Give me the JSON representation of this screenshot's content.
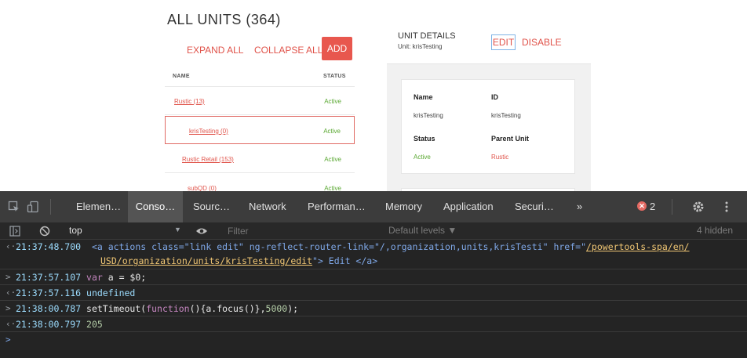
{
  "page": {
    "units_title": "ALL UNITS (364)",
    "actions": {
      "expand_all": "EXPAND ALL",
      "collapse_all": "COLLAPSE ALL",
      "add": "ADD"
    },
    "table": {
      "headers": {
        "name": "NAME",
        "status": "STATUS"
      },
      "rows": [
        {
          "name": "Rustic (13)",
          "status": "Active"
        },
        {
          "name": "krisTesting (0)",
          "status": "Active"
        },
        {
          "name": "Rustic Retail (153)",
          "status": "Active"
        },
        {
          "name": "subQD (0)",
          "status": "Active"
        }
      ]
    },
    "detail": {
      "title": "UNIT DETAILS",
      "subtitle": "Unit: krisTesting",
      "edit": "EDIT",
      "disable": "DISABLE",
      "fields": {
        "name_label": "Name",
        "name_value": "krisTesting",
        "id_label": "ID",
        "id_value": "krisTesting",
        "status_label": "Status",
        "status_value": "Active",
        "parent_label": "Parent Unit",
        "parent_value": "Rustic"
      }
    }
  },
  "devtools": {
    "tabs": [
      "Elemen…",
      "Conso…",
      "Sourc…",
      "Network",
      "Performan…",
      "Memory",
      "Application",
      "Securi…",
      "»"
    ],
    "active_tab": "Conso…",
    "error_count": "2",
    "toolbar": {
      "context": "top",
      "filter_placeholder": "Filter",
      "levels": "Default levels ▼",
      "hidden": "4 hidden"
    },
    "console": {
      "l1_ts": "21:37:48.700",
      "l1_part1": "<a actions class=\"link edit\" ng-reflect-router-link=\"/,organization,units,krisTesti\" href=\"",
      "l1_link1": "/powertools-spa/en/",
      "l1_link2": "USD/organization/units/krisTesting/edit",
      "l1_part2": "\"> Edit </a>",
      "l2_ts": "21:37:57.107",
      "l2_code_kw": "var",
      "l2_code_rest": " a = $0;",
      "l3_ts": "21:37:57.116",
      "l3_value": "undefined",
      "l4_ts": "21:38:00.787",
      "l4_code_a": "setTimeout(",
      "l4_code_kw": "function",
      "l4_code_b": "(){a.focus()},",
      "l4_num": "5000",
      "l4_code_c": ");",
      "l5_ts": "21:38:00.797",
      "l5_value": "205"
    }
  },
  "colors": {
    "accent": "#e0534a",
    "active_status": "#5aa832",
    "devtools_bg": "#242424"
  }
}
